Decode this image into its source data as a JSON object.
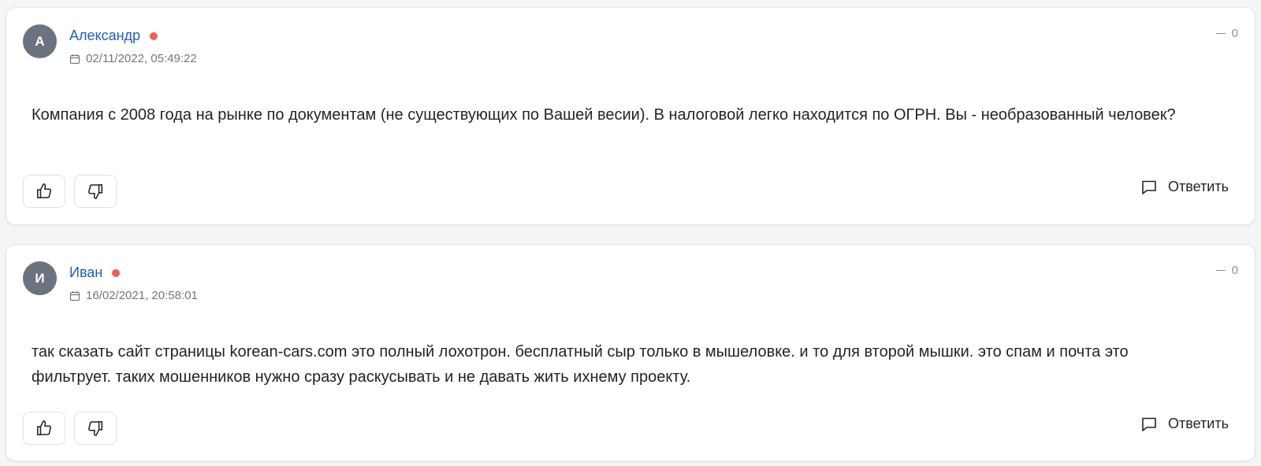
{
  "comments": [
    {
      "avatar_letter": "А",
      "author": "Александр",
      "date": "02/11/2022, 05:49:22",
      "score": "0",
      "text": "Компания с 2008 года на рынке по документам (не существующих по Вашей весии). В налоговой легко находится по ОГРН. Вы - необразованный человек?",
      "reply_label": "Ответить"
    },
    {
      "avatar_letter": "И",
      "author": "Иван",
      "date": "16/02/2021, 20:58:01",
      "score": "0",
      "text": "так сказать сайт страницы korean-cars.com это полный лохотрон. бесплатный сыр только в мышеловке. и то для второй мышки. это спам и почта это фильтрует. таких мошенников нужно сразу раскусывать и не давать жить ихнему проекту.",
      "reply_label": "Ответить"
    }
  ],
  "icons": {
    "calendar": "calendar-icon",
    "like": "thumbs-up-icon",
    "dislike": "thumbs-down-icon",
    "reply": "speech-bubble-icon"
  },
  "colors": {
    "author_link": "#1d5fbf",
    "online_dot": "#f05b5b",
    "avatar_bg": "#6c7280"
  }
}
